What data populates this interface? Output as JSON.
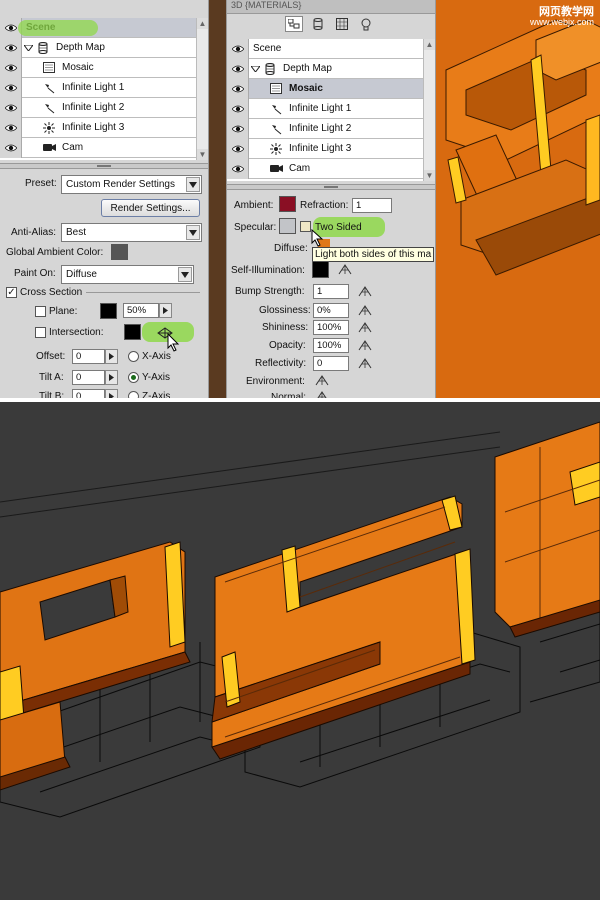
{
  "left_panel": {
    "layers": [
      {
        "label": "Scene",
        "icon": "scene-icon",
        "selected": true
      },
      {
        "label": "Depth Map",
        "icon": "mesh-icon",
        "expanded": true
      },
      {
        "label": "Mosaic",
        "icon": "texture-icon"
      },
      {
        "label": "Infinite Light 1",
        "icon": "infinite-light-icon"
      },
      {
        "label": "Infinite Light 2",
        "icon": "infinite-light-icon"
      },
      {
        "label": "Infinite Light 3",
        "icon": "point-light-icon"
      },
      {
        "label": "Cam",
        "icon": "camera-icon"
      }
    ],
    "preset_label": "Preset:",
    "preset_value": "Custom Render Settings",
    "render_settings_button": "Render Settings...",
    "anti_alias_label": "Anti-Alias:",
    "anti_alias_value": "Best",
    "global_ambient_label": "Global Ambient Color:",
    "global_ambient_color": "#555555",
    "paint_on_label": "Paint On:",
    "paint_on_value": "Diffuse",
    "cross_section_label": "Cross Section",
    "plane_label": "Plane:",
    "plane_color": "#000000",
    "plane_opacity": "50%",
    "intersection_label": "Intersection:",
    "intersection_color": "#000000",
    "offset_label": "Offset:",
    "offset_value": "0",
    "tilt_a_label": "Tilt A:",
    "tilt_a_value": "0",
    "tilt_b_label": "Tilt B:",
    "tilt_b_value": "0",
    "x_axis_label": "X-Axis",
    "y_axis_label": "Y-Axis",
    "z_axis_label": "Z-Axis"
  },
  "right_panel": {
    "tab_title": "3D {MATERIALS}",
    "layers": [
      {
        "label": "Scene",
        "icon": "scene-icon"
      },
      {
        "label": "Depth Map",
        "icon": "mesh-icon",
        "expanded": true
      },
      {
        "label": "Mosaic",
        "icon": "texture-icon",
        "selected": true
      },
      {
        "label": "Infinite Light 1",
        "icon": "infinite-light-icon"
      },
      {
        "label": "Infinite Light 2",
        "icon": "infinite-light-icon"
      },
      {
        "label": "Infinite Light 3",
        "icon": "point-light-icon"
      },
      {
        "label": "Cam",
        "icon": "camera-icon"
      }
    ],
    "ambient_label": "Ambient:",
    "ambient_color": "#8a0f24",
    "refraction_label": "Refraction:",
    "refraction_value": "1",
    "specular_label": "Specular:",
    "specular_color": "#c2c4c8",
    "two_sided_label": "Two Sided",
    "diffuse_label": "Diffuse:",
    "diffuse_color": "#e07818",
    "tooltip_text": "Light both sides of this ma",
    "self_illum_label": "Self-Illumination:",
    "self_illum_color": "#000000",
    "bump_label": "Bump Strength:",
    "bump_value": "1",
    "glossiness_label": "Glossiness:",
    "glossiness_value": "0%",
    "shininess_label": "Shininess:",
    "shininess_value": "100%",
    "opacity_label": "Opacity:",
    "opacity_value": "100%",
    "reflectivity_label": "Reflectivity:",
    "reflectivity_value": "0",
    "environment_label": "Environment:",
    "normal_label": "Normal:"
  },
  "watermark": {
    "line1": "网页教学网",
    "line2": "www.webjx.com"
  },
  "colors": {
    "panel_bg": "#d6d6d6",
    "orange": "#d86a10",
    "orange_light": "#f08a1a",
    "yellow_edge": "#ffcc22",
    "dark_bg": "#3a3a3a",
    "highlight_green": "#8fd84a"
  }
}
